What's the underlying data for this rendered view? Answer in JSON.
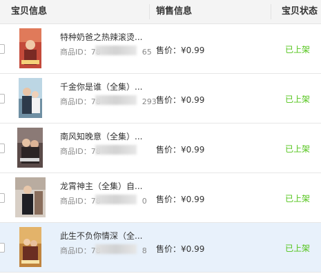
{
  "header": {
    "col_item": "宝贝信息",
    "col_sales": "销售信息",
    "col_status": "宝贝状态"
  },
  "colors": {
    "status_green": "#52c41a",
    "selected_row_bg": "#e8f1fb",
    "header_bg": "#f4f4f4"
  },
  "rows": [
    {
      "title": "特种奶爸之热辣滚烫...",
      "id_label": "商品ID：",
      "id_visible": "78",
      "id_tail": "65",
      "price": "售价：¥0.99",
      "status": "已上架",
      "selected": false
    },
    {
      "title": "千金你是谁（全集）...",
      "id_label": "商品ID：",
      "id_visible": "78",
      "id_tail": "293",
      "price": "售价：¥0.99",
      "status": "已上架",
      "selected": false
    },
    {
      "title": "南风知晚意（全集）...",
      "id_label": "商品ID：",
      "id_visible": "78",
      "id_tail": "",
      "price": "售价：¥0.99",
      "status": "已上架",
      "selected": false
    },
    {
      "title": "龙霄神主（全集）自...",
      "id_label": "商品ID：",
      "id_visible": "78",
      "id_tail": "0",
      "price": "售价：¥0.99",
      "status": "已上架",
      "selected": false
    },
    {
      "title": "此生不负你情深（全...",
      "id_label": "商品ID：",
      "id_visible": "78",
      "id_tail": "8",
      "price": "售价：¥0.99",
      "status": "已上架",
      "selected": true
    }
  ]
}
